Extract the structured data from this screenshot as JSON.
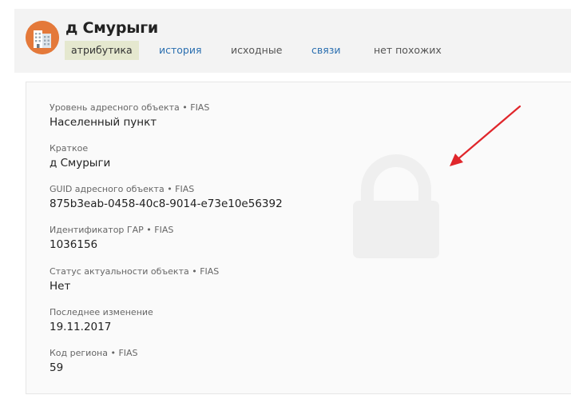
{
  "header": {
    "title": "д Смурыги",
    "tabs": [
      {
        "label": "атрибутика",
        "style": "active"
      },
      {
        "label": "история",
        "style": "link"
      },
      {
        "label": "исходные",
        "style": "plain"
      },
      {
        "label": "связи",
        "style": "link"
      },
      {
        "label": "нет похожих",
        "style": "plain"
      }
    ]
  },
  "attributes": [
    {
      "label": "Уровень адресного объекта • FIAS",
      "value": "Населенный пункт"
    },
    {
      "label": "Краткое",
      "value": "д Смурыги"
    },
    {
      "label": "GUID адресного объекта • FIAS",
      "value": "875b3eab-0458-40c8-9014-e73e10e56392"
    },
    {
      "label": "Идентификатор ГАР • FIAS",
      "value": "1036156"
    },
    {
      "label": "Статус актуальности объекта • FIAS",
      "value": "Нет"
    },
    {
      "label": "Последнее изменение",
      "value": "19.11.2017"
    },
    {
      "label": "Код региона • FIAS",
      "value": "59"
    }
  ],
  "icons": {
    "avatar": "building-icon",
    "watermark": "lock-icon",
    "annotation": "red-arrow-icon"
  },
  "colors": {
    "avatar_bg": "#e4793a",
    "active_tab_bg": "#e5e8cf",
    "link": "#2b6fb0",
    "arrow": "#e0262b"
  }
}
